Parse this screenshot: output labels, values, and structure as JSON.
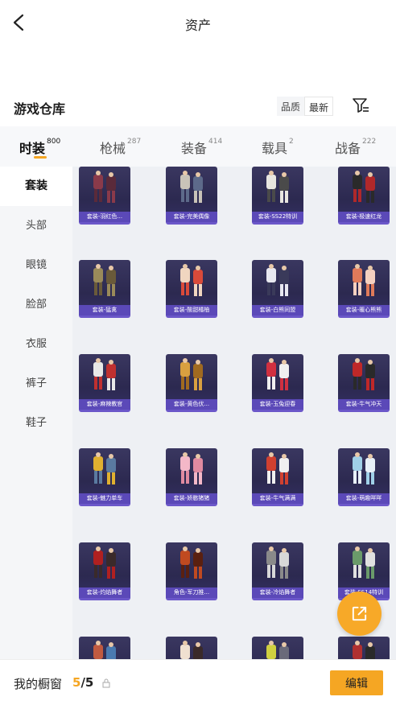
{
  "header": {
    "title": "资产"
  },
  "section": {
    "title": "游戏仓库",
    "sort_options": [
      "品质",
      "最新"
    ],
    "active_sort": "最新"
  },
  "tabs": [
    {
      "label": "时装",
      "count": "800"
    },
    {
      "label": "枪械",
      "count": "287"
    },
    {
      "label": "装备",
      "count": "414"
    },
    {
      "label": "载具",
      "count": "2"
    },
    {
      "label": "战备",
      "count": "222"
    }
  ],
  "sidebar": {
    "items": [
      "套装",
      "头部",
      "眼镜",
      "脸部",
      "衣服",
      "裤子",
      "鞋子"
    ],
    "active": "套装"
  },
  "items": [
    {
      "label": "套装-羽红色..."
    },
    {
      "label": "套装-完美偶像"
    },
    {
      "label": "套装-SS22特训"
    },
    {
      "label": "套装-极速红龙"
    },
    {
      "label": "套装-猛禽"
    },
    {
      "label": "套装-酸甜橘柚"
    },
    {
      "label": "套装-白熊同盟"
    },
    {
      "label": "套装-暖心熊熊"
    },
    {
      "label": "套装-麻辣教官"
    },
    {
      "label": "套装-黄色伏..."
    },
    {
      "label": "套装-玉兔迎春"
    },
    {
      "label": "套装-牛气冲天"
    },
    {
      "label": "套装-魅力单车"
    },
    {
      "label": "套装-娇憨猪猪"
    },
    {
      "label": "套装-牛气满满"
    },
    {
      "label": "套装-萌趣咩咩"
    },
    {
      "label": "套装-灼焰舞者"
    },
    {
      "label": "角色-军刀推..."
    },
    {
      "label": "套装-冷焰舞者"
    },
    {
      "label": "套装-SS14特训"
    },
    {
      "label": ""
    },
    {
      "label": ""
    },
    {
      "label": ""
    },
    {
      "label": ""
    }
  ],
  "showcase": {
    "label": "我的橱窗",
    "current": "5",
    "separator": "/",
    "max": "5"
  },
  "edit_button": "编辑",
  "colors": {
    "accent": "#f5a623",
    "card_bg": "#2c2950",
    "card_label": "#5b49b8"
  }
}
